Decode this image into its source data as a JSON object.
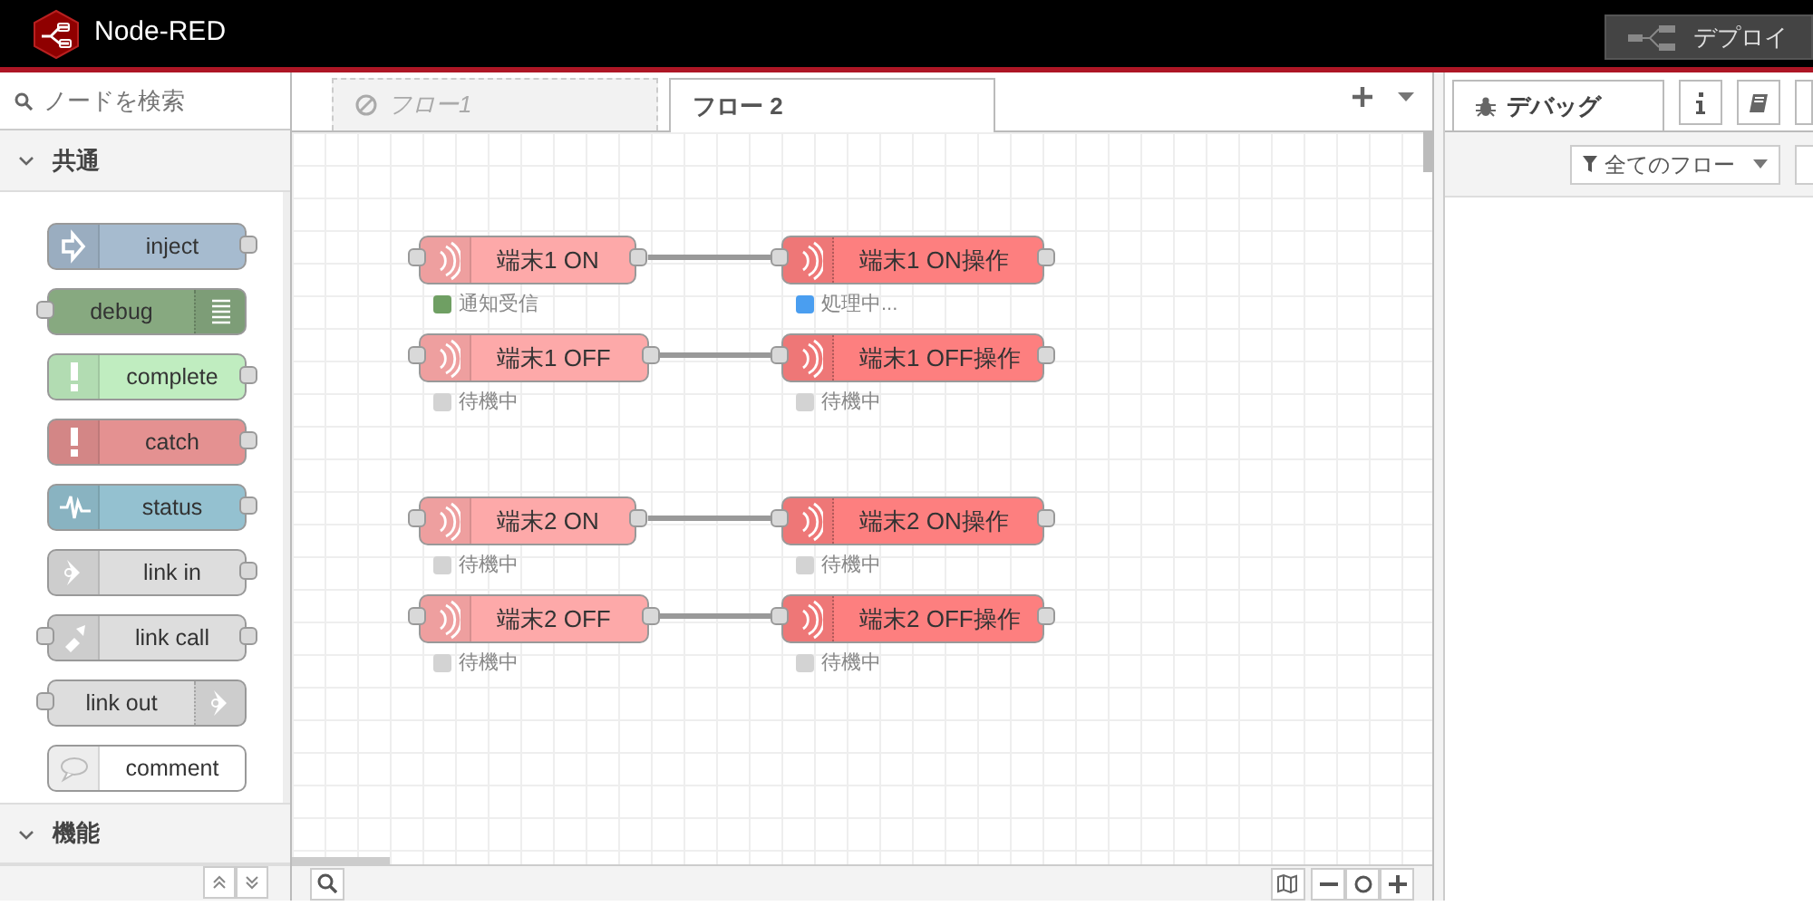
{
  "header": {
    "title": "Node-RED",
    "deploy_label": "デプロイ"
  },
  "palette": {
    "search_placeholder": "ノードを検索",
    "categories": [
      {
        "label": "共通",
        "expanded": true,
        "nodes": [
          {
            "label": "inject",
            "kind": "inject",
            "color": "#a6bbcf"
          },
          {
            "label": "debug",
            "kind": "debug",
            "color": "#87a980"
          },
          {
            "label": "complete",
            "kind": "complete",
            "color": "#c0edc0"
          },
          {
            "label": "catch",
            "kind": "catch",
            "color": "#e49191"
          },
          {
            "label": "status",
            "kind": "status",
            "color": "#94c1d0"
          },
          {
            "label": "link in",
            "kind": "link-in",
            "color": "#dddddd"
          },
          {
            "label": "link call",
            "kind": "link-call",
            "color": "#dddddd"
          },
          {
            "label": "link out",
            "kind": "link-out",
            "color": "#dddddd"
          },
          {
            "label": "comment",
            "kind": "comment",
            "color": "#ffffff"
          }
        ]
      },
      {
        "label": "機能",
        "expanded": true
      }
    ]
  },
  "workspace": {
    "tabs": [
      {
        "label": "フロー1",
        "selected": false,
        "disabled": true
      },
      {
        "label": "フロー 2",
        "selected": true,
        "disabled": false
      }
    ],
    "flows": [
      {
        "source": {
          "label": "端末1 ON",
          "status": {
            "text": "通知受信",
            "color": "#6f9f63"
          }
        },
        "target": {
          "label": "端末1 ON操作",
          "status": {
            "text": "処理中...",
            "color": "#4a9ef0"
          }
        }
      },
      {
        "source": {
          "label": "端末1 OFF",
          "status": {
            "text": "待機中",
            "color": "#d3d3d3"
          }
        },
        "target": {
          "label": "端末1 OFF操作",
          "status": {
            "text": "待機中",
            "color": "#d3d3d3"
          }
        }
      },
      {
        "source": {
          "label": "端末2 ON",
          "status": {
            "text": "待機中",
            "color": "#d3d3d3"
          }
        },
        "target": {
          "label": "端末2 ON操作",
          "status": {
            "text": "待機中",
            "color": "#d3d3d3"
          }
        }
      },
      {
        "source": {
          "label": "端末2 OFF",
          "status": {
            "text": "待機中",
            "color": "#d3d3d3"
          }
        },
        "target": {
          "label": "端末2 OFF操作",
          "status": {
            "text": "待機中",
            "color": "#d3d3d3"
          }
        }
      }
    ]
  },
  "sidebar": {
    "tabs": [
      {
        "label": "デバッグ",
        "selected": true
      }
    ],
    "filter": "全てのフロー"
  }
}
